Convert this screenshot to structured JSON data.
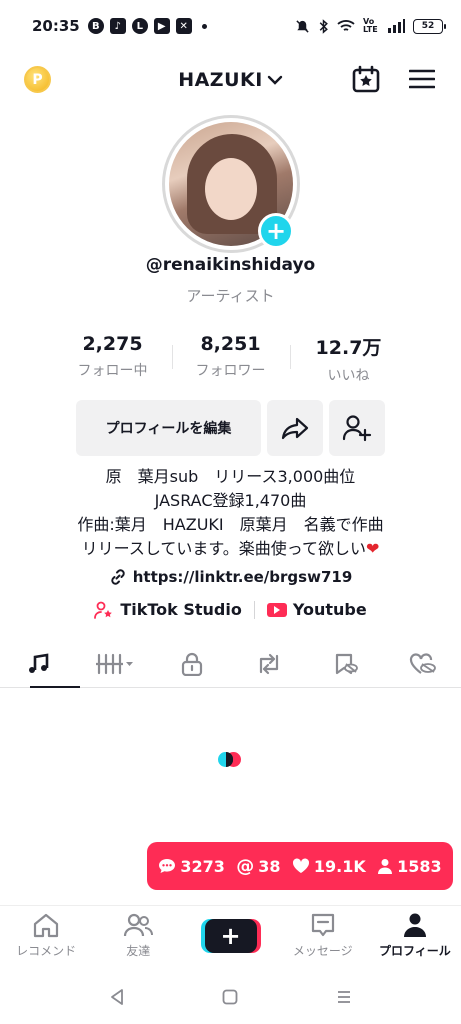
{
  "status_bar": {
    "time": "20:35",
    "network": "Vo LTE",
    "battery": "52"
  },
  "header": {
    "coin_glyph": "P",
    "username": "HAZUKI"
  },
  "profile": {
    "handle": "@renaikinshidayo",
    "category": "アーティスト",
    "stats": [
      {
        "value": "2,275",
        "label": "フォロー中"
      },
      {
        "value": "8,251",
        "label": "フォロワー"
      },
      {
        "value": "12.7万",
        "label": "いいね"
      }
    ],
    "edit_button": "プロフィールを編集",
    "bio_lines": [
      "原　葉月sub　リリース3,000曲位",
      "JASRAC登録1,470曲",
      "作曲:葉月　HAZUKI　原葉月　名義で作曲",
      "リリースしています。楽曲使って欲しい"
    ],
    "bio_heart": "❤",
    "link": "https://linktr.ee/brgsw719",
    "apps": [
      {
        "label": "TikTok Studio"
      },
      {
        "label": "Youtube"
      }
    ]
  },
  "tabs": [
    {
      "icon": "music-note-icon"
    },
    {
      "icon": "playlist-icon"
    },
    {
      "icon": "lock-icon"
    },
    {
      "icon": "repost-icon"
    },
    {
      "icon": "saved-icon"
    },
    {
      "icon": "liked-icon"
    }
  ],
  "notifications": {
    "comments": "3273",
    "mentions": "38",
    "likes": "19.1K",
    "followers": "1583"
  },
  "bottom_nav": [
    {
      "label": "レコメンド"
    },
    {
      "label": "友達"
    },
    {
      "label": ""
    },
    {
      "label": "メッセージ"
    },
    {
      "label": "プロフィール"
    }
  ],
  "colors": {
    "accent_red": "#fe2c55",
    "accent_cyan": "#20d5ec",
    "text": "#161823",
    "muted": "#8a8b91"
  }
}
